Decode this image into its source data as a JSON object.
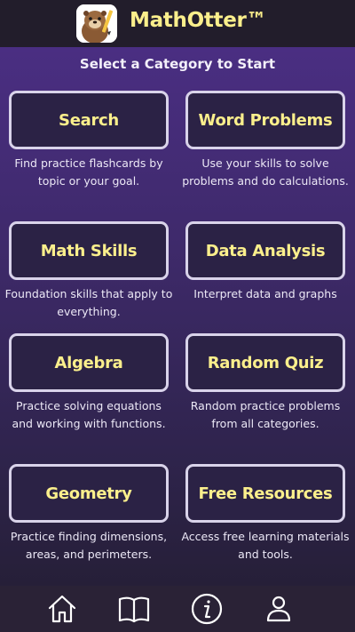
{
  "header": {
    "title": "MathOtter™",
    "logo_icon": "otter-logo-icon"
  },
  "subtitle": "Select a Category to Start",
  "categories": [
    {
      "label": "Search",
      "description": "Find practice flashcards by topic or your goal."
    },
    {
      "label": "Word Problems",
      "description": "Use your skills to solve problems and do calculations."
    },
    {
      "label": "Math Skills",
      "description": "Foundation skills that apply to everything."
    },
    {
      "label": "Data Analysis",
      "description": "Interpret data and graphs"
    },
    {
      "label": "Algebra",
      "description": "Practice solving equations and working with functions."
    },
    {
      "label": "Random Quiz",
      "description": "Random practice problems from all categories."
    },
    {
      "label": "Geometry",
      "description": "Practice finding dimensions, areas, and perimeters."
    },
    {
      "label": "Free Resources",
      "description": "Access free learning materials and tools."
    }
  ],
  "nav": {
    "items": [
      "home-icon",
      "book-icon",
      "info-icon",
      "user-icon"
    ]
  },
  "colors": {
    "accent_yellow": "#fbef8c",
    "header_bg": "#221d2b",
    "gradient_top": "#4a2e82",
    "gradient_bottom": "#261f38",
    "button_bg": "#2b2245",
    "button_border": "#d9d3ea",
    "nav_bg": "#2a2236"
  }
}
